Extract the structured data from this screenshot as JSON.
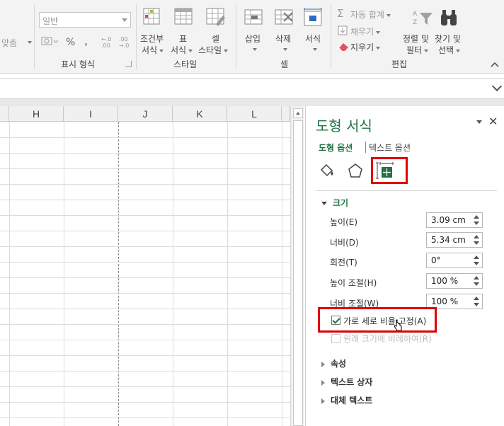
{
  "ribbon": {
    "align_label": "맞춤",
    "number_format_value": "일반",
    "percent": "%",
    "comma": ",",
    "number_group_label": "표시 형식",
    "conditional_format": [
      "조건부",
      "서식"
    ],
    "format_table": [
      "표",
      "서식"
    ],
    "cell_styles": [
      "셀",
      "스타일"
    ],
    "styles_group_label": "스타일",
    "insert": "삽입",
    "delete": "삭제",
    "format": "서식",
    "cells_group_label": "셀",
    "autosum": "자동 합계",
    "fill": "채우기",
    "clear": "지우기",
    "sort_filter": [
      "정렬 및",
      "필터"
    ],
    "find_select": [
      "찾기 및",
      "선택"
    ],
    "editing_group_label": "편집"
  },
  "grid": {
    "columns": [
      "H",
      "I",
      "J",
      "K",
      "L"
    ]
  },
  "pane": {
    "title": "도형 서식",
    "tab_shape_options": "도형 옵션",
    "tab_text_options": "텍스트 옵션",
    "section_size": "크기",
    "fields": [
      {
        "label": "높이(E)",
        "value": "3.09 cm"
      },
      {
        "label": "너비(D)",
        "value": "5.34 cm"
      },
      {
        "label": "회전(T)",
        "value": "0°"
      },
      {
        "label": "높이 조절(H)",
        "value": "100 %"
      },
      {
        "label": "너비 조절(W)",
        "value": "100 %"
      }
    ],
    "lock_aspect": "가로 세로 비율 고정(A)",
    "relative_original": "원래 크기에 비례하여(R)",
    "section_properties": "속성",
    "section_textbox": "텍스트 상자",
    "section_alt_text": "대체 텍스트"
  },
  "colors": {
    "accent": "#217346",
    "highlight": "#e00000"
  }
}
